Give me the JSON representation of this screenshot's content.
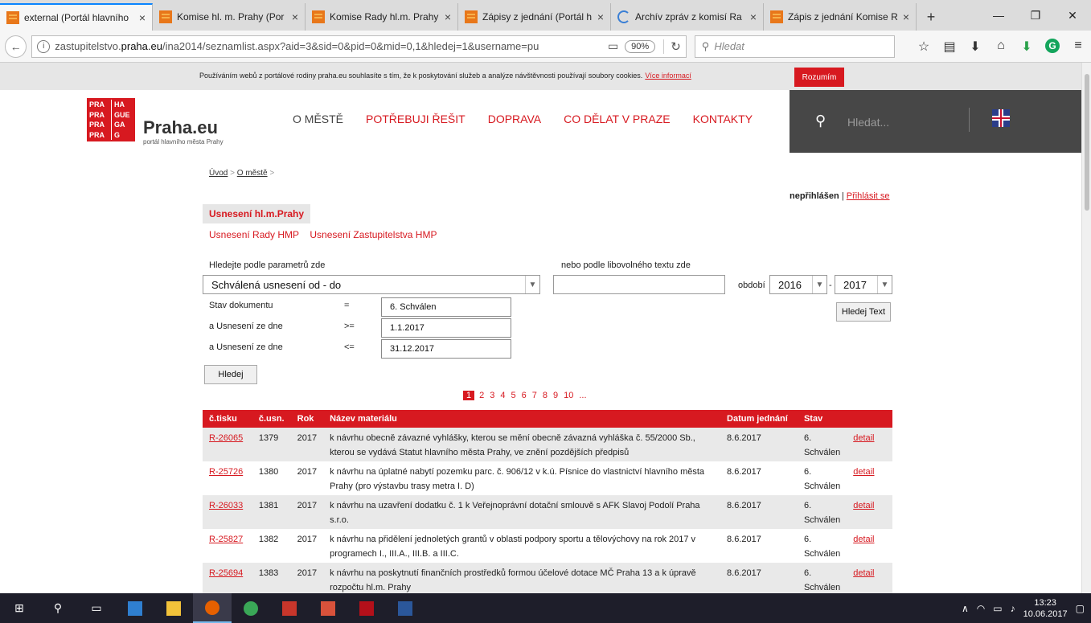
{
  "browser": {
    "tabs": [
      {
        "title": "external (Portál hlavního",
        "icon": "praha-favicon",
        "active": true
      },
      {
        "title": "Komise hl. m. Prahy (Por",
        "icon": "praha-favicon",
        "active": false
      },
      {
        "title": "Komise Rady hl.m. Prahy",
        "icon": "praha-favicon",
        "active": false
      },
      {
        "title": "Zápisy z jednání (Portál h",
        "icon": "praha-favicon",
        "active": false
      },
      {
        "title": "Archív zpráv z komisí Ra",
        "icon": "loading-icon",
        "active": false
      },
      {
        "title": "Zápis z jednání Komise R",
        "icon": "praha-favicon",
        "active": false
      }
    ],
    "url_prefix": "zastupitelstvo.",
    "url_domain": "praha.eu",
    "url_rest": "/ina2014/seznamlist.aspx?aid=3&sid=0&pid=0&mid=0,1&hledej=1&username=pu",
    "zoom": "90%",
    "search_placeholder": "Hledat"
  },
  "cookie": {
    "text": "Používáním webů z portálové rodiny praha.eu souhlasíte s tím, že k poskytování služeb a analýze návštěvnosti používají soubory cookies.",
    "link": "Více informací",
    "button": "Rozumím"
  },
  "header": {
    "logo_cells": [
      "PRA",
      "HA",
      "PRA",
      "GUE",
      "PRA",
      "GA",
      "PRA",
      "G"
    ],
    "logo_text": "Praha.eu",
    "logo_sub": "portál hlavního města Prahy",
    "nav": [
      "O MĚSTĚ",
      "POTŘEBUJI ŘEŠIT",
      "DOPRAVA",
      "CO DĚLAT V PRAZE",
      "KONTAKTY"
    ],
    "search_placeholder": "Hledat..."
  },
  "breadcrumb": {
    "home": "Úvod",
    "sep": ">",
    "current": "O městě"
  },
  "login": {
    "status": "nepřihlášen",
    "sep": "|",
    "link": "Přihlásit se"
  },
  "section": {
    "tab": "Usnesení hl.m.Prahy",
    "links": [
      "Usnesení Rady HMP",
      "Usnesení Zastupitelstva HMP"
    ]
  },
  "search": {
    "params_label": "Hledejte podle parametrů zde",
    "freetext_label": "nebo podle libovolného textu zde",
    "param_select": "Schválená usnesení od - do",
    "period_label": "období",
    "year_from": "2016",
    "year_dash": "-",
    "year_to": "2017",
    "freetext_button": "Hledej Text",
    "rows": [
      {
        "label": "Stav dokumentu",
        "op": "=",
        "value": "6. Schválen"
      },
      {
        "label": "a Usnesení ze dne",
        "op": ">=",
        "value": "1.1.2017"
      },
      {
        "label": "a Usnesení ze dne",
        "op": "<=",
        "value": "31.12.2017"
      }
    ],
    "button": "Hledej"
  },
  "pager": {
    "pages": [
      "1",
      "2",
      "3",
      "4",
      "5",
      "6",
      "7",
      "8",
      "9",
      "10",
      "..."
    ],
    "current": "1"
  },
  "table": {
    "headers": [
      "č.tisku",
      "č.usn.",
      "Rok",
      "Název materiálu",
      "Datum jednání",
      "Stav",
      ""
    ],
    "rows": [
      {
        "tisk": "R-26065",
        "usn": "1379",
        "rok": "2017",
        "nazev": "k návrhu obecně závazné vyhlášky, kterou se mění obecně závazná vyhláška č. 55/2000 Sb., kterou se vydává Statut hlavního města Prahy, ve znění pozdějších předpisů",
        "datum": "8.6.2017",
        "stav": "6. Schválen",
        "detail": "detail"
      },
      {
        "tisk": "R-25726",
        "usn": "1380",
        "rok": "2017",
        "nazev": "k návrhu na úplatné nabytí pozemku parc. č. 906/12 v k.ú. Písnice do vlastnictví hlavního města Prahy (pro výstavbu trasy metra I. D)",
        "datum": "8.6.2017",
        "stav": "6. Schválen",
        "detail": "detail"
      },
      {
        "tisk": "R-26033",
        "usn": "1381",
        "rok": "2017",
        "nazev": "k návrhu na uzavření dodatku č. 1 k Veřejnoprávní dotační smlouvě s AFK Slavoj Podolí Praha s.r.o.",
        "datum": "8.6.2017",
        "stav": "6. Schválen",
        "detail": "detail"
      },
      {
        "tisk": "R-25827",
        "usn": "1382",
        "rok": "2017",
        "nazev": "k návrhu na přidělení jednoletých grantů v oblasti podpory sportu a tělovýchovy na rok 2017 v programech I., III.A., III.B. a III.C.",
        "datum": "8.6.2017",
        "stav": "6. Schválen",
        "detail": "detail"
      },
      {
        "tisk": "R-25694",
        "usn": "1383",
        "rok": "2017",
        "nazev": "k návrhu na poskytnutí finančních prostředků formou účelové dotace MČ Praha 13 a k úpravě rozpočtu hl.m. Prahy",
        "datum": "8.6.2017",
        "stav": "6. Schválen",
        "detail": "detail"
      }
    ]
  },
  "taskbar": {
    "time": "13:23",
    "date": "10.06.2017"
  }
}
